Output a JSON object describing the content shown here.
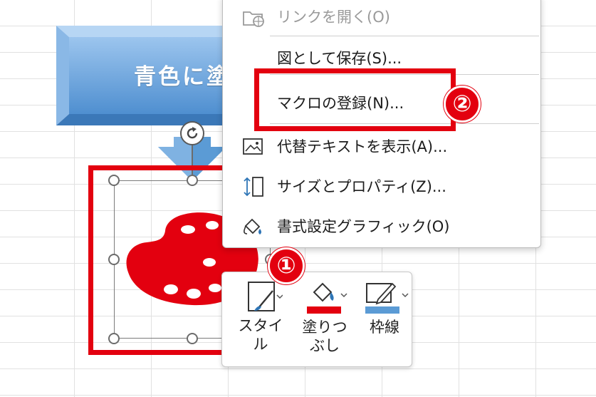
{
  "spreadsheet": {
    "blue_shape_text": "青色に塗"
  },
  "context_menu": {
    "items": [
      {
        "label": "リンクを開く(O)",
        "icon": "open-link-icon",
        "enabled": false
      },
      {
        "label": "図として保存(S)...",
        "icon": null,
        "enabled": true
      },
      {
        "label": "マクロの登録(N)...",
        "icon": null,
        "enabled": true
      },
      {
        "label": "代替テキストを表示(A)...",
        "icon": "alt-text-icon",
        "enabled": true
      },
      {
        "label": "サイズとプロパティ(Z)...",
        "icon": "size-properties-icon",
        "enabled": true
      },
      {
        "label": "書式設定グラフィック(O)",
        "icon": "format-graphic-icon",
        "enabled": true
      }
    ]
  },
  "mini_toolbar": {
    "style_label": "スタイル",
    "fill_label_line1": "塗りつ",
    "fill_label_line2": "ぶし",
    "outline_label": "枠線"
  },
  "callouts": {
    "one": "①",
    "two": "②"
  },
  "colors": {
    "highlight_red": "#e3000f",
    "fill_red": "#e3000f",
    "outline_blue": "#5b9bd5",
    "shape_blue": "#5b9bd5"
  }
}
